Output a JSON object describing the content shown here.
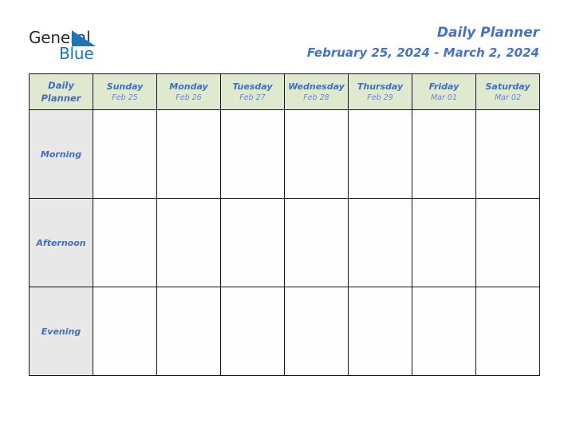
{
  "logo": {
    "word_one": "General",
    "word_two": "Blue",
    "triangle_icon": "triangle-icon",
    "accent_color": "#1b75bb"
  },
  "header": {
    "title": "Daily Planner",
    "date_range": "February 25, 2024 - March 2, 2024",
    "title_color": "#4472c4"
  },
  "table": {
    "corner": {
      "line1": "Daily",
      "line2": "Planner"
    },
    "header_bg": "#dfe9d0",
    "rowlabel_bg": "#e8e8e8",
    "cell_bg": "#fdfdfd",
    "border_color": "#151515",
    "days": [
      {
        "name": "Sunday",
        "date": "Feb 25"
      },
      {
        "name": "Monday",
        "date": "Feb 26"
      },
      {
        "name": "Tuesday",
        "date": "Feb 27"
      },
      {
        "name": "Wednesday",
        "date": "Feb 28"
      },
      {
        "name": "Thursday",
        "date": "Feb 29"
      },
      {
        "name": "Friday",
        "date": "Mar 01"
      },
      {
        "name": "Saturday",
        "date": "Mar 02"
      }
    ],
    "rows": [
      {
        "label": "Morning",
        "cells": [
          "",
          "",
          "",
          "",
          "",
          "",
          ""
        ]
      },
      {
        "label": "Afternoon",
        "cells": [
          "",
          "",
          "",
          "",
          "",
          "",
          ""
        ]
      },
      {
        "label": "Evening",
        "cells": [
          "",
          "",
          "",
          "",
          "",
          "",
          ""
        ]
      }
    ]
  }
}
